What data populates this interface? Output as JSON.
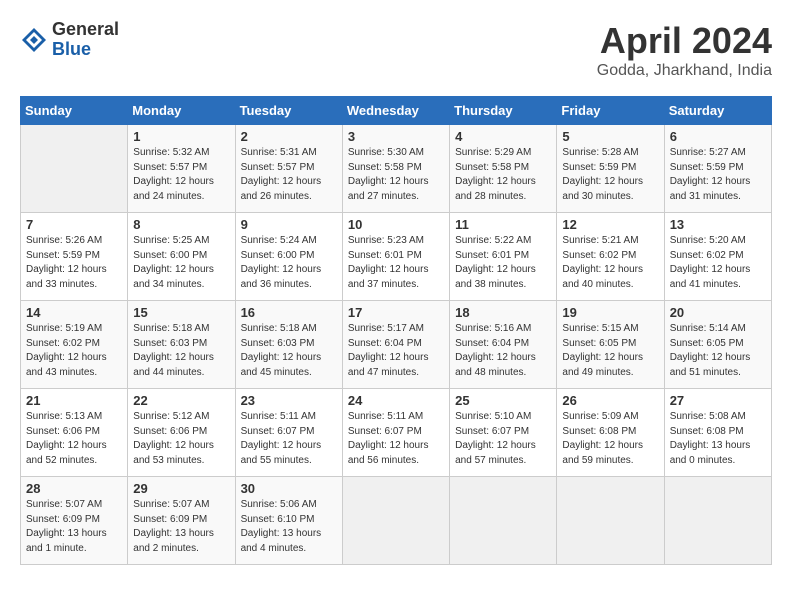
{
  "header": {
    "logo_general": "General",
    "logo_blue": "Blue",
    "month_year": "April 2024",
    "location": "Godda, Jharkhand, India"
  },
  "columns": [
    "Sunday",
    "Monday",
    "Tuesday",
    "Wednesday",
    "Thursday",
    "Friday",
    "Saturday"
  ],
  "weeks": [
    [
      {
        "day": "",
        "info": ""
      },
      {
        "day": "1",
        "info": "Sunrise: 5:32 AM\nSunset: 5:57 PM\nDaylight: 12 hours\nand 24 minutes."
      },
      {
        "day": "2",
        "info": "Sunrise: 5:31 AM\nSunset: 5:57 PM\nDaylight: 12 hours\nand 26 minutes."
      },
      {
        "day": "3",
        "info": "Sunrise: 5:30 AM\nSunset: 5:58 PM\nDaylight: 12 hours\nand 27 minutes."
      },
      {
        "day": "4",
        "info": "Sunrise: 5:29 AM\nSunset: 5:58 PM\nDaylight: 12 hours\nand 28 minutes."
      },
      {
        "day": "5",
        "info": "Sunrise: 5:28 AM\nSunset: 5:59 PM\nDaylight: 12 hours\nand 30 minutes."
      },
      {
        "day": "6",
        "info": "Sunrise: 5:27 AM\nSunset: 5:59 PM\nDaylight: 12 hours\nand 31 minutes."
      }
    ],
    [
      {
        "day": "7",
        "info": "Sunrise: 5:26 AM\nSunset: 5:59 PM\nDaylight: 12 hours\nand 33 minutes."
      },
      {
        "day": "8",
        "info": "Sunrise: 5:25 AM\nSunset: 6:00 PM\nDaylight: 12 hours\nand 34 minutes."
      },
      {
        "day": "9",
        "info": "Sunrise: 5:24 AM\nSunset: 6:00 PM\nDaylight: 12 hours\nand 36 minutes."
      },
      {
        "day": "10",
        "info": "Sunrise: 5:23 AM\nSunset: 6:01 PM\nDaylight: 12 hours\nand 37 minutes."
      },
      {
        "day": "11",
        "info": "Sunrise: 5:22 AM\nSunset: 6:01 PM\nDaylight: 12 hours\nand 38 minutes."
      },
      {
        "day": "12",
        "info": "Sunrise: 5:21 AM\nSunset: 6:02 PM\nDaylight: 12 hours\nand 40 minutes."
      },
      {
        "day": "13",
        "info": "Sunrise: 5:20 AM\nSunset: 6:02 PM\nDaylight: 12 hours\nand 41 minutes."
      }
    ],
    [
      {
        "day": "14",
        "info": "Sunrise: 5:19 AM\nSunset: 6:02 PM\nDaylight: 12 hours\nand 43 minutes."
      },
      {
        "day": "15",
        "info": "Sunrise: 5:18 AM\nSunset: 6:03 PM\nDaylight: 12 hours\nand 44 minutes."
      },
      {
        "day": "16",
        "info": "Sunrise: 5:18 AM\nSunset: 6:03 PM\nDaylight: 12 hours\nand 45 minutes."
      },
      {
        "day": "17",
        "info": "Sunrise: 5:17 AM\nSunset: 6:04 PM\nDaylight: 12 hours\nand 47 minutes."
      },
      {
        "day": "18",
        "info": "Sunrise: 5:16 AM\nSunset: 6:04 PM\nDaylight: 12 hours\nand 48 minutes."
      },
      {
        "day": "19",
        "info": "Sunrise: 5:15 AM\nSunset: 6:05 PM\nDaylight: 12 hours\nand 49 minutes."
      },
      {
        "day": "20",
        "info": "Sunrise: 5:14 AM\nSunset: 6:05 PM\nDaylight: 12 hours\nand 51 minutes."
      }
    ],
    [
      {
        "day": "21",
        "info": "Sunrise: 5:13 AM\nSunset: 6:06 PM\nDaylight: 12 hours\nand 52 minutes."
      },
      {
        "day": "22",
        "info": "Sunrise: 5:12 AM\nSunset: 6:06 PM\nDaylight: 12 hours\nand 53 minutes."
      },
      {
        "day": "23",
        "info": "Sunrise: 5:11 AM\nSunset: 6:07 PM\nDaylight: 12 hours\nand 55 minutes."
      },
      {
        "day": "24",
        "info": "Sunrise: 5:11 AM\nSunset: 6:07 PM\nDaylight: 12 hours\nand 56 minutes."
      },
      {
        "day": "25",
        "info": "Sunrise: 5:10 AM\nSunset: 6:07 PM\nDaylight: 12 hours\nand 57 minutes."
      },
      {
        "day": "26",
        "info": "Sunrise: 5:09 AM\nSunset: 6:08 PM\nDaylight: 12 hours\nand 59 minutes."
      },
      {
        "day": "27",
        "info": "Sunrise: 5:08 AM\nSunset: 6:08 PM\nDaylight: 13 hours\nand 0 minutes."
      }
    ],
    [
      {
        "day": "28",
        "info": "Sunrise: 5:07 AM\nSunset: 6:09 PM\nDaylight: 13 hours\nand 1 minute."
      },
      {
        "day": "29",
        "info": "Sunrise: 5:07 AM\nSunset: 6:09 PM\nDaylight: 13 hours\nand 2 minutes."
      },
      {
        "day": "30",
        "info": "Sunrise: 5:06 AM\nSunset: 6:10 PM\nDaylight: 13 hours\nand 4 minutes."
      },
      {
        "day": "",
        "info": ""
      },
      {
        "day": "",
        "info": ""
      },
      {
        "day": "",
        "info": ""
      },
      {
        "day": "",
        "info": ""
      }
    ]
  ]
}
